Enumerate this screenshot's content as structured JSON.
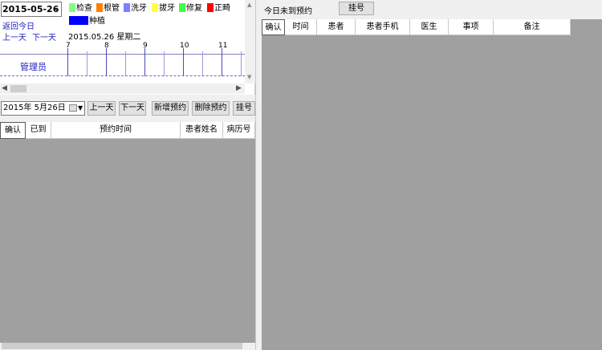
{
  "schedule": {
    "date_select": "2015-05-26",
    "legend": [
      {
        "label": "检查",
        "color": "#80ff80"
      },
      {
        "label": "根管",
        "color": "#ff8000"
      },
      {
        "label": "洗牙",
        "color": "#8080ff"
      },
      {
        "label": "拔牙",
        "color": "#ffff40"
      },
      {
        "label": "修复",
        "color": "#40ff40"
      },
      {
        "label": "正畸",
        "color": "#ff0000"
      },
      {
        "label": "种植",
        "color": "#0000ff"
      }
    ],
    "back_today": "返回今日",
    "prev_day_link": "上一天",
    "next_day_link": "下一天",
    "date_display": "2015.05.26  星期二",
    "hours": [
      "7",
      "8",
      "9",
      "10",
      "11"
    ],
    "doctor": "管理员"
  },
  "toolbar": {
    "date_value": "2015年  5月26日",
    "prev_day": "上一天",
    "next_day": "下一天",
    "new_appt": "新增预约",
    "delete_appt": "删除预约",
    "register": "挂号"
  },
  "left_table": {
    "columns": [
      "确认",
      "已到",
      "预约时间",
      "患者姓名",
      "病历号"
    ]
  },
  "right": {
    "title": "今日未到预约",
    "register": "挂号",
    "columns": [
      "确认",
      "时间",
      "患者",
      "患者手机",
      "医生",
      "事项",
      "备注"
    ]
  }
}
